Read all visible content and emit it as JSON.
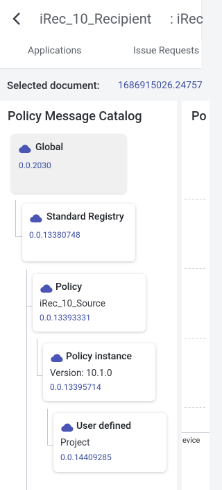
{
  "header": {
    "title": "iRec_10_Recipient",
    "title_continued": ": iRec"
  },
  "tabs": [
    {
      "label": "Applications"
    },
    {
      "label": "Issue Requests"
    }
  ],
  "selection": {
    "label": "Selected document:",
    "value": "1686915026.24757"
  },
  "catalog": {
    "title": "Policy Message Catalog",
    "nodes": [
      {
        "type": "Global",
        "subtitle": "",
        "id": "0.0.2030"
      },
      {
        "type": "Standard Registry",
        "subtitle": "",
        "id": "0.0.13380748"
      },
      {
        "type": "Policy",
        "subtitle": "iRec_10_Source",
        "id": "0.0.13393331"
      },
      {
        "type": "Policy instance",
        "subtitle": "Version: 10.1.0",
        "id": "0.0.13395714"
      },
      {
        "type": "User defined",
        "subtitle": "Project",
        "id": "0.0.14409285"
      }
    ]
  },
  "side_panel": {
    "title": "Po",
    "snippet": "evice"
  },
  "colors": {
    "accent": "#3d4fa3",
    "icon": "#4a55b5"
  },
  "icons": {
    "back": "chevron-left-icon",
    "node": "cloud-icon"
  }
}
